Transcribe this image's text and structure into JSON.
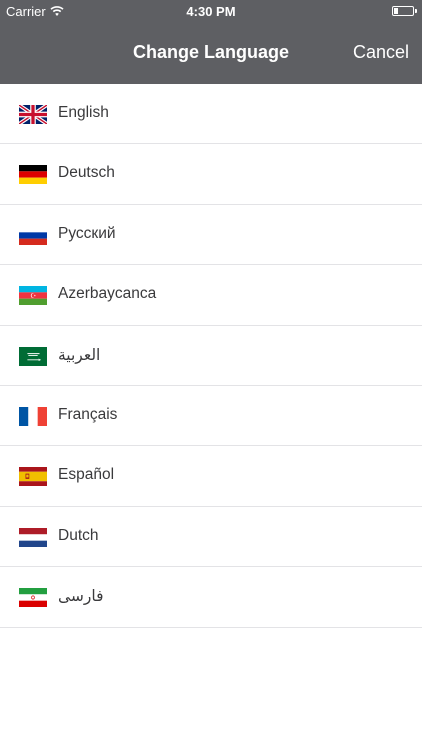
{
  "status_bar": {
    "carrier": "Carrier",
    "time": "4:30 PM"
  },
  "nav": {
    "title": "Change Language",
    "cancel_label": "Cancel"
  },
  "colors": {
    "nav_background": "#5e5f63",
    "separator": "#e3e3e6",
    "text": "#3a3a3c"
  },
  "languages": [
    {
      "label": "English",
      "flag": "uk-flag-icon"
    },
    {
      "label": "Deutsch",
      "flag": "germany-flag-icon"
    },
    {
      "label": "Русский",
      "flag": "russia-flag-icon"
    },
    {
      "label": "Azerbaycanca",
      "flag": "azerbaijan-flag-icon"
    },
    {
      "label": "العربية",
      "flag": "saudi-arabia-flag-icon"
    },
    {
      "label": "Français",
      "flag": "france-flag-icon"
    },
    {
      "label": "Español",
      "flag": "spain-flag-icon"
    },
    {
      "label": "Dutch",
      "flag": "netherlands-flag-icon"
    },
    {
      "label": "فارسی",
      "flag": "iran-flag-icon"
    }
  ]
}
